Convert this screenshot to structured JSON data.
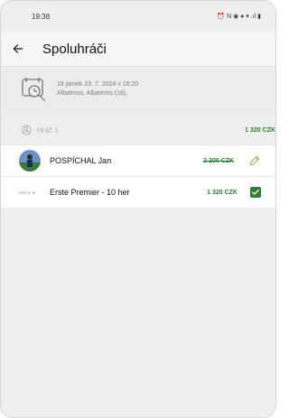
{
  "status": {
    "time": "19:38",
    "icons": "⏰ N ◉ ● ▾ .ıl ▮"
  },
  "appbar": {
    "title": "Spoluhráči"
  },
  "info": {
    "line1": "18 jamek 23. 7. 2024 v 16:20",
    "line2": "Albatross, Albatross (18)."
  },
  "player": {
    "label": "Hráč 1",
    "total": "1 320 CZK"
  },
  "rows": [
    {
      "name": "POSPÍCHAL Jan",
      "price_old": "2 200 CZK"
    },
    {
      "logo": "ERSTE ⊛",
      "name": "Erste Premier - 10 her",
      "price": "1 320 CZK"
    }
  ],
  "colors": {
    "accent": "#2e7d32",
    "background": "#efefef"
  }
}
